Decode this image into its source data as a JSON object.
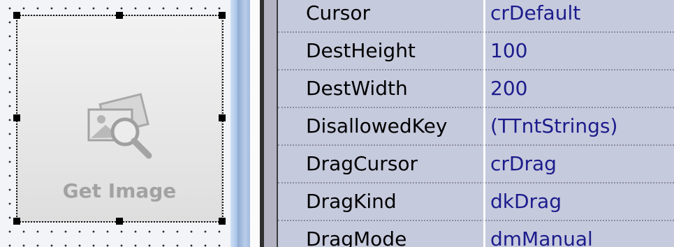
{
  "component": {
    "label": "Get Image",
    "icon": "image-search-icon"
  },
  "inspector": {
    "properties": [
      {
        "name": "Cursor",
        "value": "crDefault"
      },
      {
        "name": "DestHeight",
        "value": "100"
      },
      {
        "name": "DestWidth",
        "value": "200"
      },
      {
        "name": "DisallowedKey",
        "value": "(TTntStrings)"
      },
      {
        "name": "DragCursor",
        "value": "crDrag"
      },
      {
        "name": "DragKind",
        "value": "dkDrag"
      },
      {
        "name": "DragMode",
        "value": "dmManual"
      }
    ]
  },
  "colors": {
    "grid_background": "#c6cadd",
    "value_text": "#1c1c8c",
    "component_label": "#a2a2a2"
  }
}
